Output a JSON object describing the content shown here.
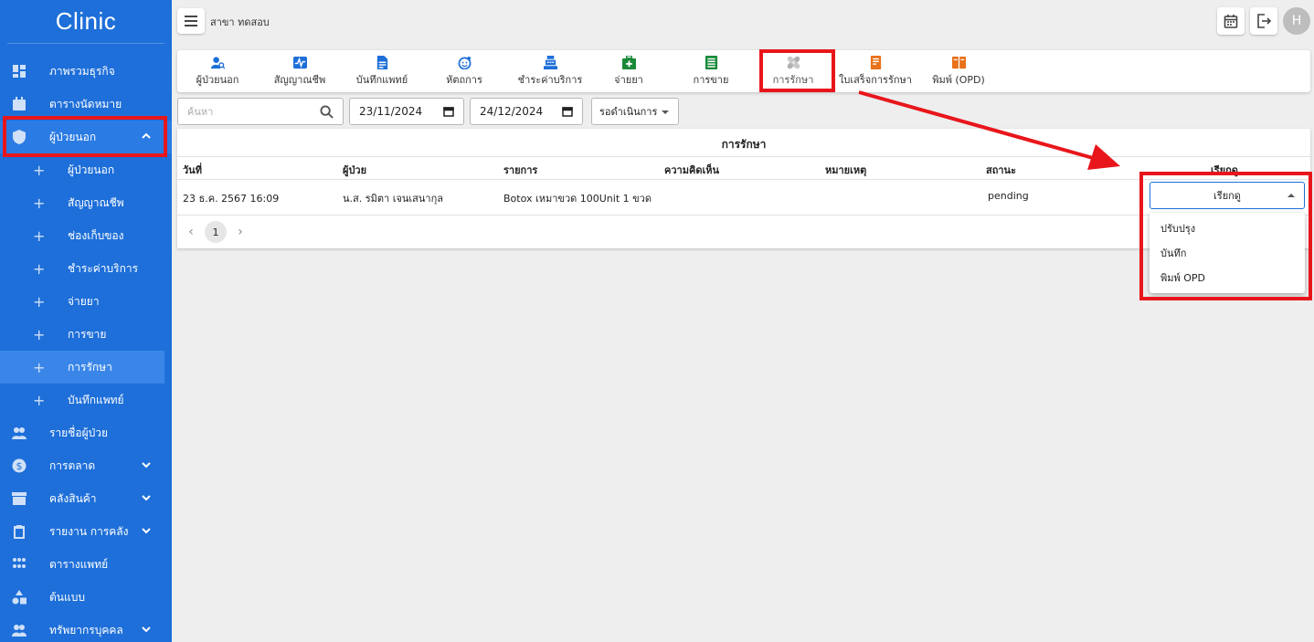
{
  "app": {
    "brand": "Clinic"
  },
  "sidebar": {
    "items_top": [
      {
        "label": "ภาพรวมธุรกิจ",
        "icon": "dashboard-icon"
      },
      {
        "label": "ตารางนัดหมาย",
        "icon": "calendar-icon"
      },
      {
        "label": "ผู้ป่วยนอก",
        "icon": "shield-icon"
      }
    ],
    "sub_items": [
      {
        "label": "ผู้ป่วยนอก"
      },
      {
        "label": "สัญญาณชีพ"
      },
      {
        "label": "ช่องเก็บของ"
      },
      {
        "label": "ชำระค่าบริการ"
      },
      {
        "label": "จ่ายยา"
      },
      {
        "label": "การขาย"
      },
      {
        "label": "การรักษา"
      },
      {
        "label": "บันทึกแพทย์"
      }
    ],
    "items_bottom": [
      {
        "label": "รายชื่อผู้ป่วย",
        "icon": "patients-icon"
      },
      {
        "label": "การตลาด",
        "icon": "dollar-icon"
      },
      {
        "label": "คลังสินค้า",
        "icon": "inventory-icon"
      },
      {
        "label": "รายงาน การคลัง",
        "icon": "clipboard-icon"
      },
      {
        "label": "ตารางแพทย์",
        "icon": "doctors-icon"
      },
      {
        "label": "ต้นแบบ",
        "icon": "shapes-icon"
      },
      {
        "label": "ทรัพยากรบุคคล",
        "icon": "people-icon"
      }
    ]
  },
  "topbar": {
    "branch": "สาขา ทดสอบ",
    "avatar_letter": "H"
  },
  "tabs": [
    {
      "label": "ผู้ป่วยนอก",
      "icon": "person-search-icon",
      "color": "#1e6fd9"
    },
    {
      "label": "สัญญาณชีพ",
      "icon": "vital-signs-icon",
      "color": "#1e6fd9"
    },
    {
      "label": "บันทึกแพทย์",
      "icon": "document-icon",
      "color": "#1e6fd9"
    },
    {
      "label": "หัตถการ",
      "icon": "face-icon",
      "color": "#1e6fd9"
    },
    {
      "label": "ชำระค่าบริการ",
      "icon": "cash-register-icon",
      "color": "#1e6fd9"
    },
    {
      "label": "จ่ายยา",
      "icon": "medkit-icon",
      "color": "#1a8a3a"
    },
    {
      "label": "การขาย",
      "icon": "ledger-icon",
      "color": "#1a8a3a"
    },
    {
      "label": "การรักษา",
      "icon": "bandage-icon",
      "color": "#9e9e9e"
    },
    {
      "label": "ใบเสร็จการรักษา",
      "icon": "receipt-icon",
      "color": "#e8711a"
    },
    {
      "label": "พิมพ์ (OPD)",
      "icon": "print-book-icon",
      "color": "#e8711a"
    }
  ],
  "filters": {
    "search_placeholder": "ค้นหา",
    "date_from": "23/11/2024",
    "date_to": "24/12/2024",
    "status": "รอดำเนินการ"
  },
  "table": {
    "title": "การรักษา",
    "headers": [
      "วันที่",
      "ผู้ป่วย",
      "รายการ",
      "ความคิดเห็น",
      "หมายเหตุ",
      "สถานะ",
      "เรียกดู"
    ],
    "rows": [
      {
        "date": "23 ธ.ค. 2567 16:09",
        "patient": "น.ส. รมิตา เจนเสนากุล",
        "item": "Botox เหมาขวด 100Unit 1 ขวด",
        "comment": "",
        "note": "",
        "status": "pending"
      }
    ],
    "page": "1"
  },
  "view_dropdown": {
    "selected": "เรียกดู",
    "options": [
      "ปรับปรุง",
      "บันทึก",
      "พิมพ์ OPD"
    ]
  },
  "colors": {
    "sidebar": "#1e6fd9",
    "highlight": "#e8161b"
  }
}
